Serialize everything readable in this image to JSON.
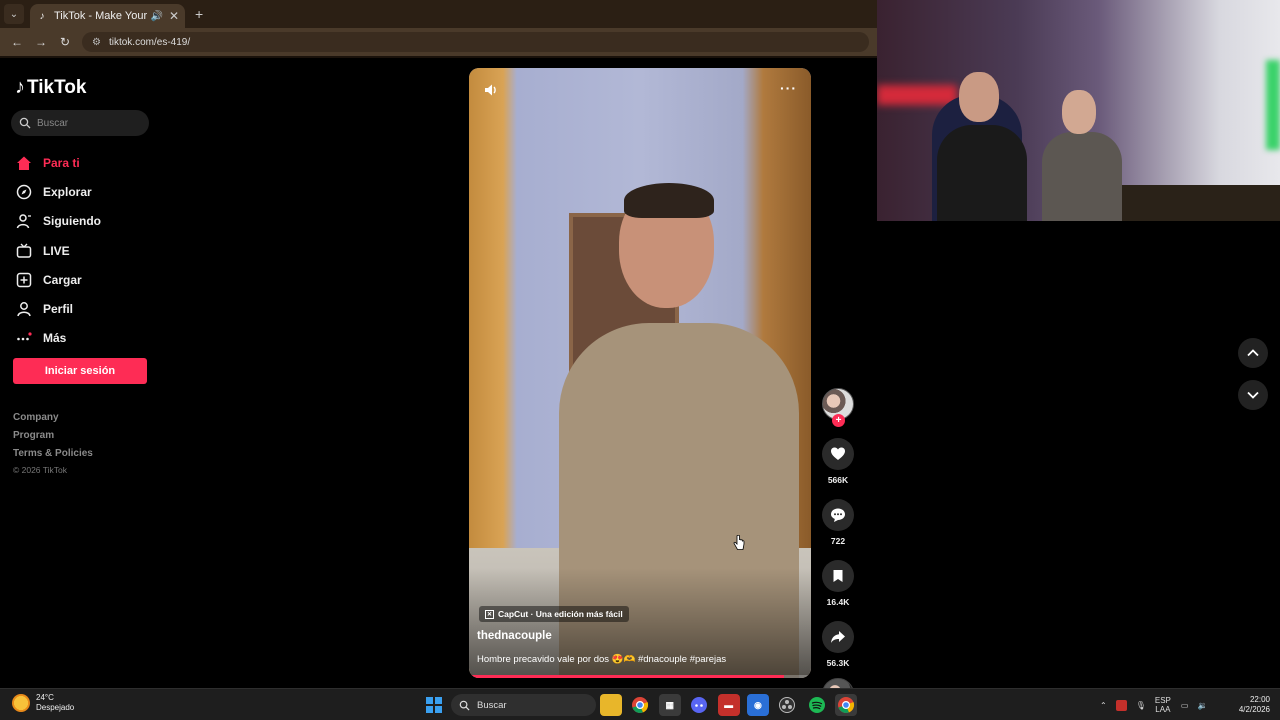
{
  "browser": {
    "tab_title": "TikTok - Make Your Day",
    "url": "tiktok.com/es-419/",
    "new_tab_symbol": "+"
  },
  "sidebar": {
    "logo_text": "TikTok",
    "search_placeholder": "Buscar",
    "nav": [
      {
        "label": "Para ti",
        "icon": "home-icon",
        "active": true
      },
      {
        "label": "Explorar",
        "icon": "compass-icon"
      },
      {
        "label": "Siguiendo",
        "icon": "person-icon"
      },
      {
        "label": "LIVE",
        "icon": "live-tv-icon"
      },
      {
        "label": "Cargar",
        "icon": "upload-plus-icon"
      },
      {
        "label": "Perfil",
        "icon": "profile-icon"
      },
      {
        "label": "Más",
        "icon": "more-dots-icon"
      }
    ],
    "login_label": "Iniciar sesión",
    "footer_links": [
      "Company",
      "Program",
      "Terms & Policies"
    ],
    "copyright": "© 2026 TikTok"
  },
  "video": {
    "capcut_label": "CapCut · Una edición más fácil",
    "username": "thednacouple",
    "description": "Hombre precavido vale por dos 😍🫶 #dnacouple #parejas",
    "progress": 0.92
  },
  "actions": {
    "likes": "566K",
    "comments": "722",
    "saves": "16.4K",
    "shares": "56.3K"
  },
  "taskbar": {
    "weather_temp": "24°C",
    "weather_desc": "Despejado",
    "search_placeholder": "Buscar",
    "lang_line1": "ESP",
    "lang_line2": "LAA",
    "time": "22:00",
    "date": "4/2/2026"
  },
  "colors": {
    "accent": "#fe2c55",
    "background": "#000000"
  }
}
